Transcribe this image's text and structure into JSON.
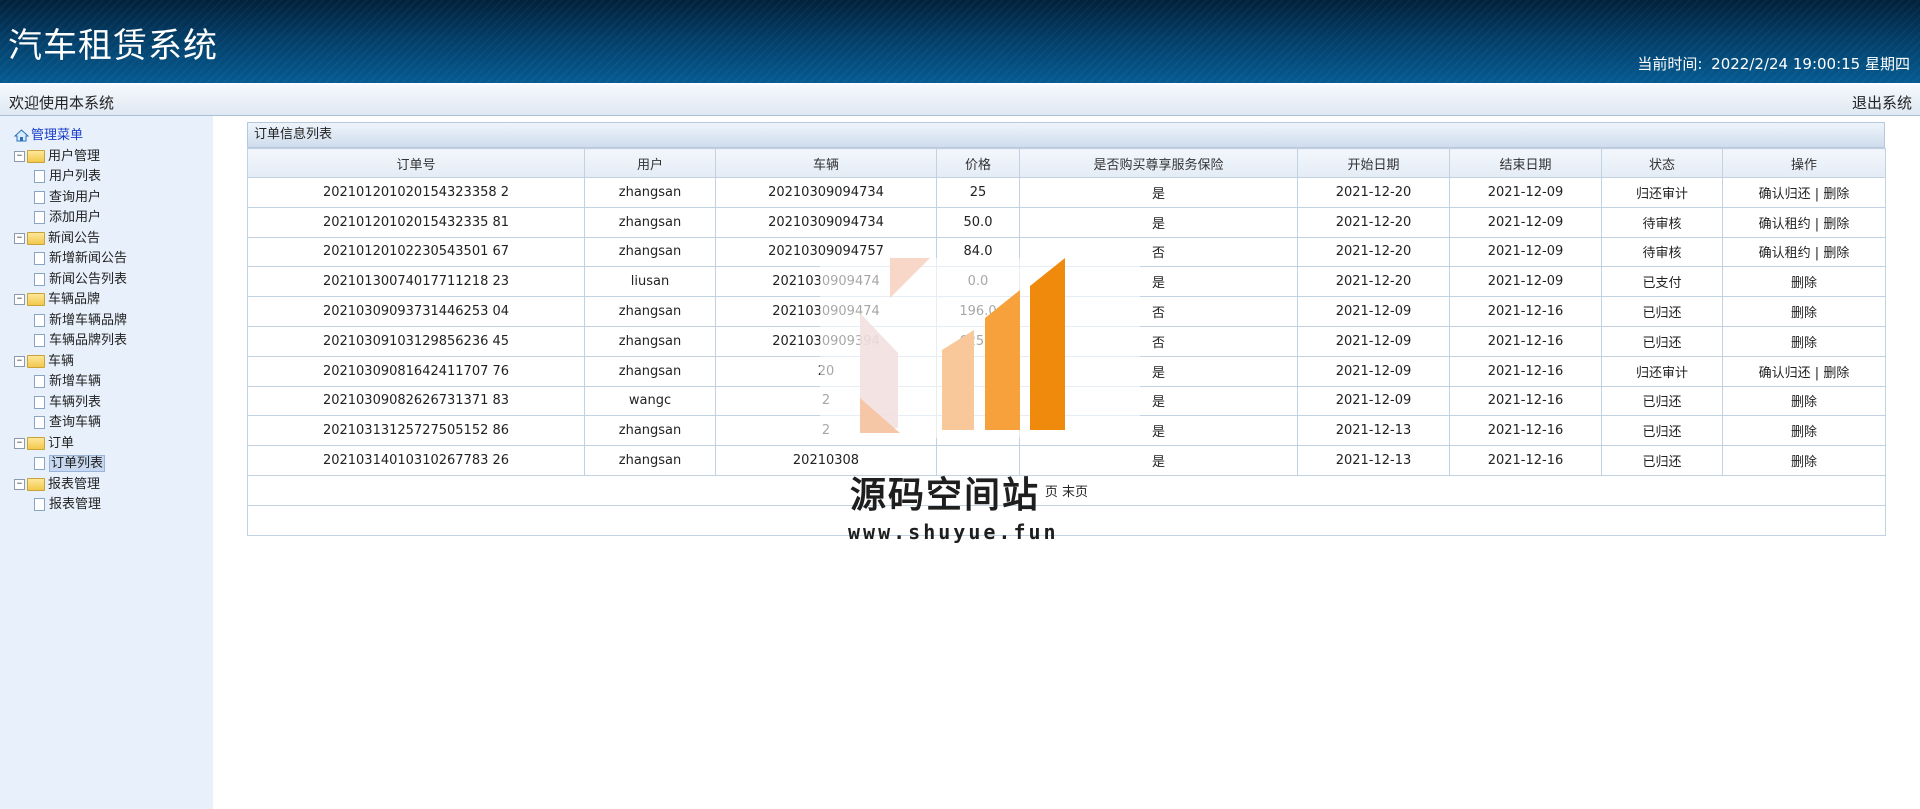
{
  "header": {
    "title": "汽车租赁系统",
    "clock_label": "当前时间:",
    "clock_value": "2022/2/24 19:00:15 星期四"
  },
  "topbar": {
    "welcome": "欢迎使用本系统",
    "logout": "退出系统"
  },
  "sidebar": {
    "root": "管理菜单",
    "groups": [
      {
        "label": "用户管理",
        "items": [
          "用户列表",
          "查询用户",
          "添加用户"
        ]
      },
      {
        "label": "新闻公告",
        "items": [
          "新增新闻公告",
          "新闻公告列表"
        ]
      },
      {
        "label": "车辆品牌",
        "items": [
          "新增车辆品牌",
          "车辆品牌列表"
        ]
      },
      {
        "label": "车辆",
        "items": [
          "新增车辆",
          "车辆列表",
          "查询车辆"
        ]
      },
      {
        "label": "订单",
        "items": [
          "订单列表"
        ]
      },
      {
        "label": "报表管理",
        "items": [
          "报表管理"
        ]
      }
    ],
    "selected": "订单列表"
  },
  "panel": {
    "title": "订单信息列表"
  },
  "table": {
    "headers": [
      "订单号",
      "用户",
      "车辆",
      "价格",
      "是否购买尊享服务保险",
      "开始日期",
      "结束日期",
      "状态",
      "操作"
    ],
    "rows": [
      [
        "202101201020154323358 2",
        "zhangsan",
        "20210309094734",
        "25",
        "是",
        "2021-12-20",
        "2021-12-09",
        "归还审计",
        [
          "确认归还",
          "删除"
        ]
      ],
      [
        "20210120102015432335 81",
        "zhangsan",
        "20210309094734",
        "50.0",
        "是",
        "2021-12-20",
        "2021-12-09",
        "待审核",
        [
          "确认租约",
          "删除"
        ]
      ],
      [
        "20210120102230543501 67",
        "zhangsan",
        "20210309094757",
        "84.0",
        "否",
        "2021-12-20",
        "2021-12-09",
        "待审核",
        [
          "确认租约",
          "删除"
        ]
      ],
      [
        "20210130074017711218 23",
        "liusan",
        "2021030909474",
        "0.0",
        "是",
        "2021-12-20",
        "2021-12-09",
        "已支付",
        [
          "删除"
        ]
      ],
      [
        "20210309093731446253 04",
        "zhangsan",
        "2021030909474",
        "196.0",
        "否",
        "2021-12-09",
        "2021-12-16",
        "已归还",
        [
          "删除"
        ]
      ],
      [
        "20210309103129856236 45",
        "zhangsan",
        "2021030909394",
        "625.0",
        "否",
        "2021-12-09",
        "2021-12-16",
        "已归还",
        [
          "删除"
        ]
      ],
      [
        "20210309081642411707 76",
        "zhangsan",
        "20",
        "",
        "是",
        "2021-12-09",
        "2021-12-16",
        "归还审计",
        [
          "确认归还",
          "删除"
        ]
      ],
      [
        "20210309082626731371 83",
        "wangc",
        "2",
        "",
        "是",
        "2021-12-09",
        "2021-12-16",
        "已归还",
        [
          "删除"
        ]
      ],
      [
        "20210313125727505152 86",
        "zhangsan",
        "2",
        "",
        "是",
        "2021-12-13",
        "2021-12-16",
        "已归还",
        [
          "删除"
        ]
      ],
      [
        "20210314010310267783 26",
        "zhangsan",
        "20210308",
        "",
        "是",
        "2021-12-13",
        "2021-12-16",
        "已归还",
        [
          "删除"
        ]
      ]
    ]
  },
  "pager": {
    "text": "页 末页"
  },
  "watermark": {
    "title": "源码空间站",
    "url": "www.shuyue.fun"
  },
  "colors": {
    "header_dark": "#02213b",
    "header_light": "#045b92",
    "sidebar_bg": "#e7f0fb",
    "border": "#c3d2e3"
  }
}
